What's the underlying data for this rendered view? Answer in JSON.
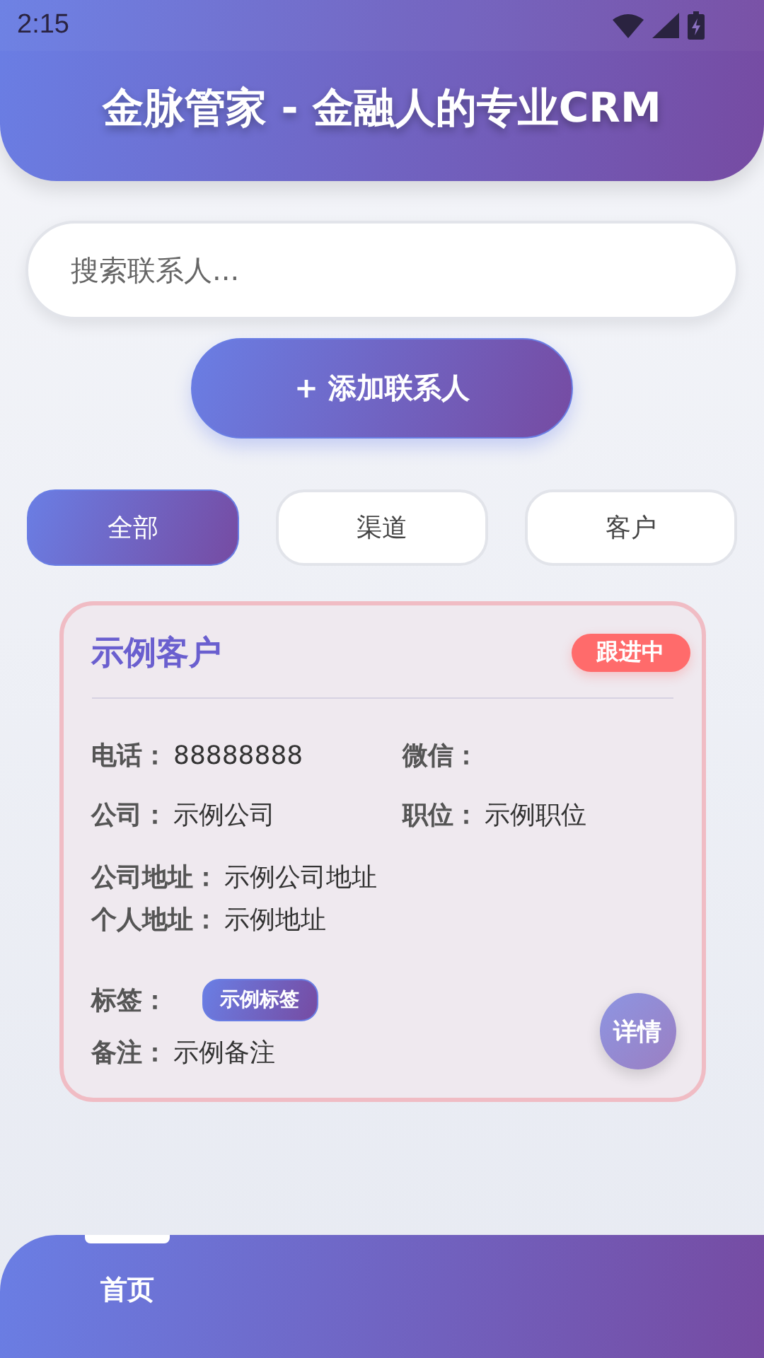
{
  "status_bar": {
    "time": "2:15"
  },
  "header": {
    "title": "金脉管家 - 金融人的专业CRM"
  },
  "search": {
    "placeholder": "搜索联系人..."
  },
  "add_button": {
    "label": "+ 添加联系人"
  },
  "filters": [
    {
      "label": "全部",
      "selected": true
    },
    {
      "label": "渠道",
      "selected": false
    },
    {
      "label": "客户",
      "selected": false
    }
  ],
  "contacts": [
    {
      "name": "示例客户",
      "status": "跟进中",
      "color": "#ff6b6b",
      "pairs": [
        [
          {
            "label": "电话：",
            "value": "88888888"
          },
          {
            "label": "微信："
          }
        ],
        [
          {
            "label": "公司：",
            "value": "示例公司"
          },
          {
            "label": "职位：",
            "value": "示例职位"
          }
        ]
      ],
      "addresses": [
        {
          "label": "公司地址：",
          "value": "示例公司地址"
        },
        {
          "label": "个人地址：",
          "value": "示例地址"
        }
      ],
      "tags_label": "标签：",
      "tags": [
        "示例标签"
      ],
      "note": {
        "label": "备注：",
        "value": "示例备注"
      },
      "detail_button": "详情"
    }
  ],
  "bottom_nav": [
    {
      "label": "首页",
      "selected": true
    }
  ]
}
